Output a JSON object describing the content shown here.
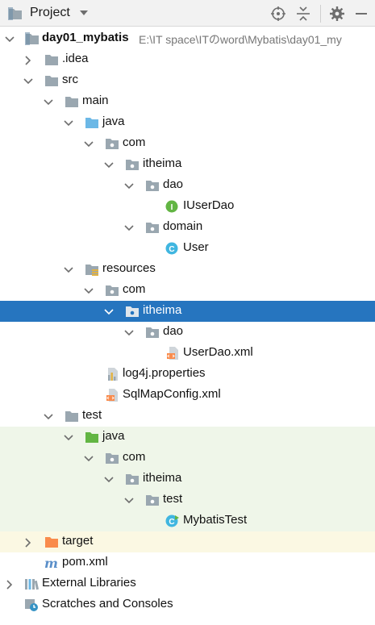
{
  "header": {
    "title": "Project"
  },
  "project": {
    "name": "day01_mybatis",
    "path": "E:\\IT space\\ITのword\\Mybatis\\day01_my"
  },
  "tree": {
    "idea": ".idea",
    "src": "src",
    "main": "main",
    "java": "java",
    "com": "com",
    "itheima": "itheima",
    "dao": "dao",
    "iuserdao": "IUserDao",
    "domain": "domain",
    "user": "User",
    "resources": "resources",
    "res_com": "com",
    "res_itheima": "itheima",
    "res_dao": "dao",
    "userdao_xml": "UserDao.xml",
    "log4j": "log4j.properties",
    "sqlmap": "SqlMapConfig.xml",
    "test": "test",
    "test_java": "java",
    "test_com": "com",
    "test_itheima": "itheima",
    "test_test": "test",
    "mybatistest": "MybatisTest",
    "target": "target",
    "pom": "pom.xml",
    "external_libraries": "External Libraries",
    "scratches": "Scratches and Consoles"
  },
  "colors": {
    "selection": "#2675bf",
    "test_bg": "#eff6e9",
    "excluded_bg": "#fbf8e3",
    "folder": "#9aa7b0",
    "source_folder": "#6cb8e6",
    "test_folder": "#62b543",
    "excluded_folder": "#f98b4c",
    "interface": "#62b543",
    "class": "#40b6e0"
  }
}
